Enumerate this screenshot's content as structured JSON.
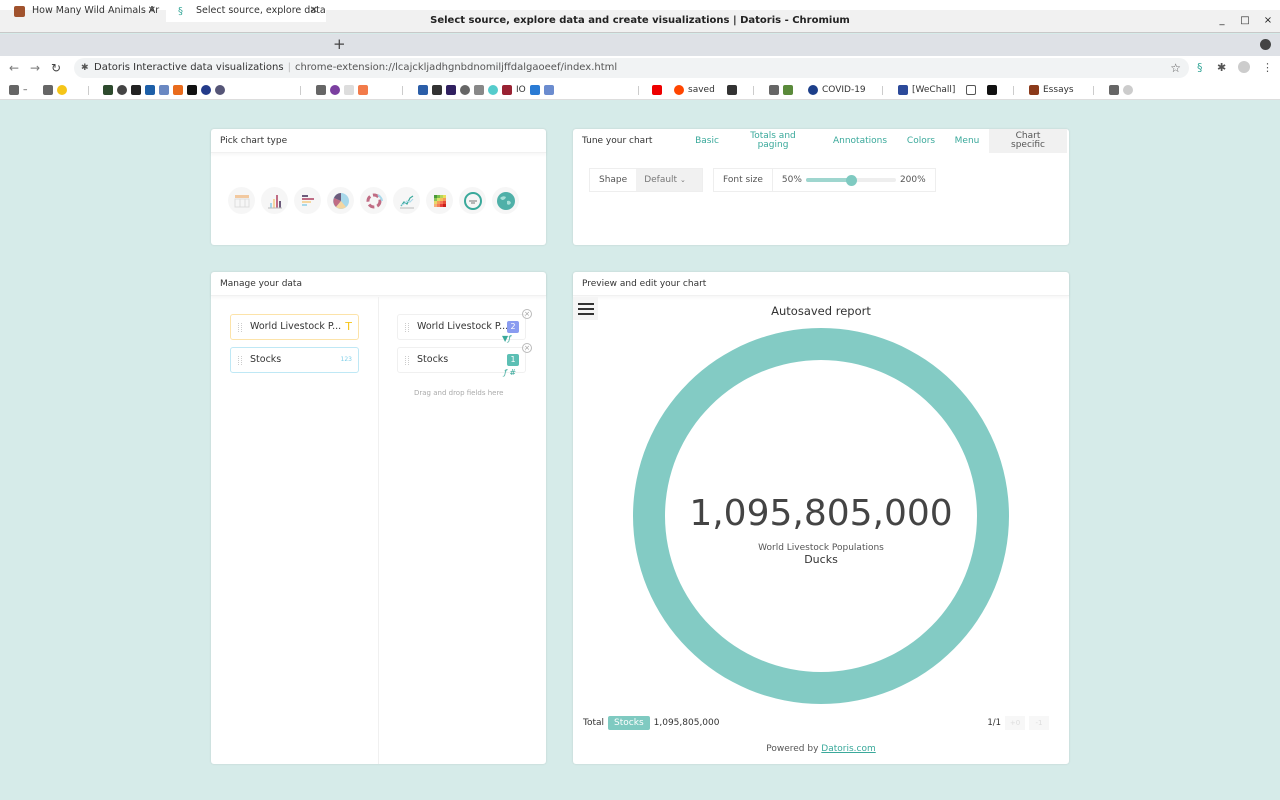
{
  "window": {
    "title": "Select source, explore data and create visualizations | Datoris - Chromium",
    "controls": [
      "_",
      "□",
      "×"
    ]
  },
  "tabs": [
    {
      "label": "How Many Wild Animals Ar",
      "active": false
    },
    {
      "label": "Select source, explore data",
      "active": true
    }
  ],
  "toolbar": {
    "site_name": "Datoris Interactive data visualizations",
    "url": "chrome-extension://lcajckljadhgnbdnomiljffdalgaoeef/index.html"
  },
  "bookmarks": {
    "labeled": [
      "saved",
      "COVID-19",
      "[WeChall]",
      "Essays"
    ]
  },
  "pick_chart": {
    "title": "Pick chart type",
    "types": [
      "table-icon",
      "column-chart-icon",
      "bar-chart-icon",
      "pie-chart-icon",
      "sunburst-icon",
      "line-chart-icon",
      "heatmap-icon",
      "donut-icon",
      "map-icon"
    ]
  },
  "tune": {
    "title": "Tune your chart",
    "tabs": [
      "Basic",
      "Totals and paging",
      "Annotations",
      "Colors",
      "Menu",
      "Chart specific"
    ],
    "selected_tab": "Chart specific",
    "shape_label": "Shape",
    "shape_value": "Default",
    "font_size_label": "Font size",
    "font_min": "50%",
    "font_max": "200%",
    "font_value_fraction": 0.5
  },
  "manage": {
    "title": "Manage your data",
    "available_fields": [
      {
        "name": "World Livestock P...",
        "type": "text"
      },
      {
        "name": "Stocks",
        "type": "number"
      }
    ],
    "selected_fields": [
      {
        "name": "World Livestock P...",
        "badge": "2"
      },
      {
        "name": "Stocks",
        "badge": "1"
      }
    ],
    "drop_hint": "Drag and drop fields here"
  },
  "preview": {
    "title": "Preview and edit your chart",
    "report_title": "Autosaved report",
    "value": "1,095,805,000",
    "series_label": "World Livestock Populations",
    "category": "Ducks",
    "total_label": "Total",
    "total_chip": "Stocks",
    "total_value": "1,095,805,000",
    "page": "1/1",
    "pager_buttons": [
      "+0",
      "-1"
    ],
    "powered_by": "Powered by",
    "powered_link": "Datoris.com",
    "donut_color": "#83cbc4"
  },
  "chart_data": {
    "type": "pie",
    "title": "Autosaved report",
    "categories": [
      "Ducks"
    ],
    "values": [
      1095805000
    ],
    "series_name": "Stocks",
    "legend": "none"
  }
}
